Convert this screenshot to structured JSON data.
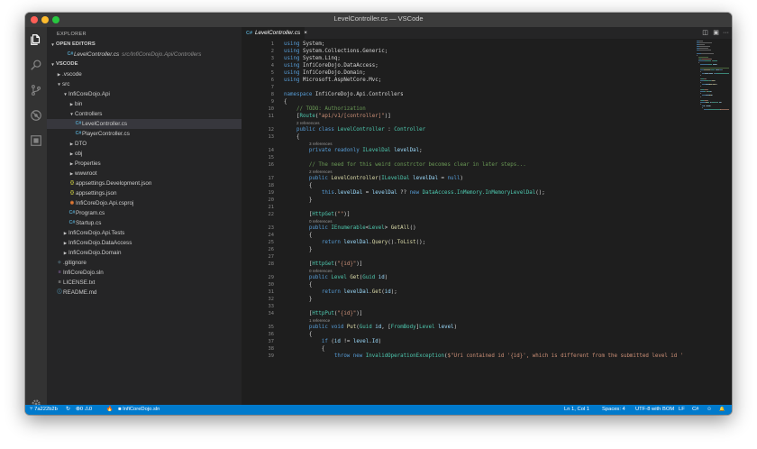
{
  "window": {
    "title": "LevelController.cs — VSCode"
  },
  "activity_bar": {
    "items": [
      {
        "name": "explorer-icon",
        "active": true
      },
      {
        "name": "search-icon",
        "active": false
      },
      {
        "name": "source-control-icon",
        "active": false
      },
      {
        "name": "debug-icon",
        "active": false
      },
      {
        "name": "extensions-icon",
        "active": false
      }
    ],
    "bottom": {
      "name": "gear-icon"
    }
  },
  "sidebar": {
    "title": "EXPLORER",
    "sections": {
      "open_editors": "OPEN EDITORS",
      "project": "VSCODE"
    },
    "open_editors": [
      {
        "icon": "C#",
        "label": "LevelController.cs",
        "desc": "src/InfiCoreDojo.Api/Controllers"
      }
    ],
    "tree": [
      {
        "label": ".vscode",
        "kind": "folder",
        "open": false
      },
      {
        "label": "src",
        "kind": "folder",
        "open": true
      },
      {
        "label": "InfiCoreDojo.Api",
        "kind": "folder",
        "open": true
      },
      {
        "label": "bin",
        "kind": "folder",
        "open": false
      },
      {
        "label": "Controllers",
        "kind": "folder",
        "open": true
      },
      {
        "label": "LevelController.cs",
        "kind": "cs"
      },
      {
        "label": "PlayerController.cs",
        "kind": "cs"
      },
      {
        "label": "DTO",
        "kind": "folder",
        "open": false
      },
      {
        "label": "obj",
        "kind": "folder",
        "open": false
      },
      {
        "label": "Properties",
        "kind": "folder",
        "open": false
      },
      {
        "label": "wwwroot",
        "kind": "folder",
        "open": false
      },
      {
        "label": "appsettings.Development.json",
        "kind": "json"
      },
      {
        "label": "appsettings.json",
        "kind": "json"
      },
      {
        "label": "InfiCoreDojo.Api.csproj",
        "kind": "csproj"
      },
      {
        "label": "Program.cs",
        "kind": "cs"
      },
      {
        "label": "Startup.cs",
        "kind": "cs"
      },
      {
        "label": "InfiCoreDojo.Api.Tests",
        "kind": "folder",
        "open": false
      },
      {
        "label": "InfiCoreDojo.DataAccess",
        "kind": "folder",
        "open": false
      },
      {
        "label": "InfiCoreDojo.Domain",
        "kind": "folder",
        "open": false
      },
      {
        "label": ".gitignore",
        "kind": "git"
      },
      {
        "label": "InfiCoreDojo.sln",
        "kind": "sln"
      },
      {
        "label": "LICENSE.txt",
        "kind": "txt"
      },
      {
        "label": "README.md",
        "kind": "md"
      }
    ]
  },
  "editor": {
    "tab": {
      "icon": "C#",
      "label": "LevelController.cs",
      "close": "×"
    },
    "tab_actions": {
      "split": "◫",
      "layout": "▣",
      "more": "···"
    },
    "lines": [
      {
        "n": 1,
        "spans": [
          [
            "k",
            "using "
          ],
          [
            "p",
            "System;"
          ]
        ]
      },
      {
        "n": 2,
        "spans": [
          [
            "k",
            "using "
          ],
          [
            "p",
            "System.Collections.Generic;"
          ]
        ]
      },
      {
        "n": 3,
        "spans": [
          [
            "k",
            "using "
          ],
          [
            "p",
            "System.Linq;"
          ]
        ]
      },
      {
        "n": 4,
        "spans": [
          [
            "k",
            "using "
          ],
          [
            "p",
            "InfiCoreDojo.DataAccess;"
          ]
        ]
      },
      {
        "n": 5,
        "spans": [
          [
            "k",
            "using "
          ],
          [
            "p",
            "InfiCoreDojo.Domain;"
          ]
        ]
      },
      {
        "n": 6,
        "spans": [
          [
            "k",
            "using "
          ],
          [
            "p",
            "Microsoft.AspNetCore.Mvc;"
          ]
        ]
      },
      {
        "n": 7,
        "spans": []
      },
      {
        "n": 8,
        "spans": [
          [
            "k",
            "namespace "
          ],
          [
            "p",
            "InfiCoreDojo.Api.Controllers"
          ]
        ]
      },
      {
        "n": 9,
        "spans": [
          [
            "p",
            "{"
          ]
        ]
      },
      {
        "n": 10,
        "spans": [
          [
            "p",
            "    "
          ],
          [
            "c",
            "// TODO: Authorization"
          ]
        ]
      },
      {
        "n": 11,
        "spans": [
          [
            "p",
            "    ["
          ],
          [
            "t",
            "Route"
          ],
          [
            "p",
            "("
          ],
          [
            "s",
            "\"api/v1/[controller]\""
          ],
          [
            "p",
            ")]"
          ]
        ]
      },
      {
        "n": 12,
        "lens": "2 references",
        "spans": [
          [
            "p",
            "    "
          ],
          [
            "k",
            "public class "
          ],
          [
            "t",
            "LevelController"
          ],
          [
            "p",
            " : "
          ],
          [
            "t",
            "Controller"
          ]
        ]
      },
      {
        "n": 13,
        "spans": [
          [
            "p",
            "    {"
          ]
        ]
      },
      {
        "n": 14,
        "lens": "3 references",
        "spans": [
          [
            "p",
            "        "
          ],
          [
            "k",
            "private readonly "
          ],
          [
            "t",
            "ILevelDal"
          ],
          [
            "p",
            " "
          ],
          [
            "v",
            "levelDal"
          ],
          [
            "p",
            ";"
          ]
        ]
      },
      {
        "n": 15,
        "spans": []
      },
      {
        "n": 16,
        "spans": [
          [
            "p",
            "        "
          ],
          [
            "c",
            "// The need for this weird constrctor becomes clear in later steps..."
          ]
        ]
      },
      {
        "n": 17,
        "lens": "2 references",
        "spans": [
          [
            "p",
            "        "
          ],
          [
            "k",
            "public "
          ],
          [
            "f",
            "LevelController"
          ],
          [
            "p",
            "("
          ],
          [
            "t",
            "ILevelDal"
          ],
          [
            "p",
            " "
          ],
          [
            "v",
            "levelDal"
          ],
          [
            "p",
            " = "
          ],
          [
            "k",
            "null"
          ],
          [
            "p",
            ")"
          ]
        ]
      },
      {
        "n": 18,
        "spans": [
          [
            "p",
            "        {"
          ]
        ]
      },
      {
        "n": 19,
        "spans": [
          [
            "p",
            "            "
          ],
          [
            "k",
            "this"
          ],
          [
            "p",
            "."
          ],
          [
            "v",
            "levelDal"
          ],
          [
            "p",
            " = "
          ],
          [
            "v",
            "levelDal"
          ],
          [
            "p",
            " ?? "
          ],
          [
            "k",
            "new "
          ],
          [
            "t",
            "DataAccess.InMemory.InMemoryLevelDal"
          ],
          [
            "p",
            "();"
          ]
        ]
      },
      {
        "n": 20,
        "spans": [
          [
            "p",
            "        }"
          ]
        ]
      },
      {
        "n": 21,
        "spans": []
      },
      {
        "n": 22,
        "spans": [
          [
            "p",
            "        ["
          ],
          [
            "t",
            "HttpGet"
          ],
          [
            "p",
            "("
          ],
          [
            "s",
            "\"\""
          ],
          [
            "p",
            ")]"
          ]
        ]
      },
      {
        "n": 23,
        "lens": "0 references",
        "spans": [
          [
            "p",
            "        "
          ],
          [
            "k",
            "public "
          ],
          [
            "t",
            "IEnumerable"
          ],
          [
            "p",
            "<"
          ],
          [
            "t",
            "Level"
          ],
          [
            "p",
            "> "
          ],
          [
            "f",
            "GetAll"
          ],
          [
            "p",
            "()"
          ]
        ]
      },
      {
        "n": 24,
        "spans": [
          [
            "p",
            "        {"
          ]
        ]
      },
      {
        "n": 25,
        "spans": [
          [
            "p",
            "            "
          ],
          [
            "k",
            "return "
          ],
          [
            "v",
            "levelDal"
          ],
          [
            "p",
            "."
          ],
          [
            "f",
            "Query"
          ],
          [
            "p",
            "()."
          ],
          [
            "f",
            "ToList"
          ],
          [
            "p",
            "();"
          ]
        ]
      },
      {
        "n": 26,
        "spans": [
          [
            "p",
            "        }"
          ]
        ]
      },
      {
        "n": 27,
        "spans": []
      },
      {
        "n": 28,
        "spans": [
          [
            "p",
            "        ["
          ],
          [
            "t",
            "HttpGet"
          ],
          [
            "p",
            "("
          ],
          [
            "s",
            "\"{id}\""
          ],
          [
            "p",
            ")]"
          ]
        ]
      },
      {
        "n": 29,
        "lens": "0 references",
        "spans": [
          [
            "p",
            "        "
          ],
          [
            "k",
            "public "
          ],
          [
            "t",
            "Level"
          ],
          [
            "p",
            " "
          ],
          [
            "f",
            "Get"
          ],
          [
            "p",
            "("
          ],
          [
            "t",
            "Guid"
          ],
          [
            "p",
            " "
          ],
          [
            "v",
            "id"
          ],
          [
            "p",
            ")"
          ]
        ]
      },
      {
        "n": 30,
        "spans": [
          [
            "p",
            "        {"
          ]
        ]
      },
      {
        "n": 31,
        "spans": [
          [
            "p",
            "            "
          ],
          [
            "k",
            "return "
          ],
          [
            "v",
            "levelDal"
          ],
          [
            "p",
            "."
          ],
          [
            "f",
            "Get"
          ],
          [
            "p",
            "("
          ],
          [
            "v",
            "id"
          ],
          [
            "p",
            ");"
          ]
        ]
      },
      {
        "n": 32,
        "spans": [
          [
            "p",
            "        }"
          ]
        ]
      },
      {
        "n": 33,
        "spans": []
      },
      {
        "n": 34,
        "spans": [
          [
            "p",
            "        ["
          ],
          [
            "t",
            "HttpPut"
          ],
          [
            "p",
            "("
          ],
          [
            "s",
            "\"{id}\""
          ],
          [
            "p",
            ")]"
          ]
        ]
      },
      {
        "n": 35,
        "lens": "1 reference",
        "spans": [
          [
            "p",
            "        "
          ],
          [
            "k",
            "public void "
          ],
          [
            "f",
            "Put"
          ],
          [
            "p",
            "("
          ],
          [
            "t",
            "Guid"
          ],
          [
            "p",
            " "
          ],
          [
            "v",
            "id"
          ],
          [
            "p",
            ", ["
          ],
          [
            "t",
            "FromBody"
          ],
          [
            "p",
            "]"
          ],
          [
            "t",
            "Level"
          ],
          [
            "p",
            " "
          ],
          [
            "v",
            "level"
          ],
          [
            "p",
            ")"
          ]
        ]
      },
      {
        "n": 36,
        "spans": [
          [
            "p",
            "        {"
          ]
        ]
      },
      {
        "n": 37,
        "spans": [
          [
            "p",
            "            "
          ],
          [
            "k",
            "if "
          ],
          [
            "p",
            "("
          ],
          [
            "v",
            "id"
          ],
          [
            "p",
            " != "
          ],
          [
            "v",
            "level"
          ],
          [
            "p",
            "."
          ],
          [
            "v",
            "Id"
          ],
          [
            "p",
            ")"
          ]
        ]
      },
      {
        "n": 38,
        "spans": [
          [
            "p",
            "            {"
          ]
        ]
      },
      {
        "n": 39,
        "spans": [
          [
            "p",
            "                "
          ],
          [
            "k",
            "throw new "
          ],
          [
            "t",
            "InvalidOperationException"
          ],
          [
            "p",
            "("
          ],
          [
            "s",
            "$\"Uri contained id '{id}', which is different from the submitted level id '"
          ]
        ]
      }
    ]
  },
  "statusbar": {
    "branch": "7a222b2b",
    "sync": "↻",
    "errors": "0",
    "warnings": "0",
    "solution": "InfiCoreDojo.sln",
    "position": "Ln 1, Col 1",
    "spaces": "Spaces: 4",
    "encoding": "UTF-8 with BOM",
    "eol": "LF",
    "language": "C#",
    "feedback": "☺",
    "bell": "🔔"
  },
  "colors": {
    "accent": "#007acc",
    "csharp_icon": "#519aba",
    "json_icon": "#cbcb41",
    "csproj_icon": "#e37933",
    "md_icon": "#519aba"
  }
}
